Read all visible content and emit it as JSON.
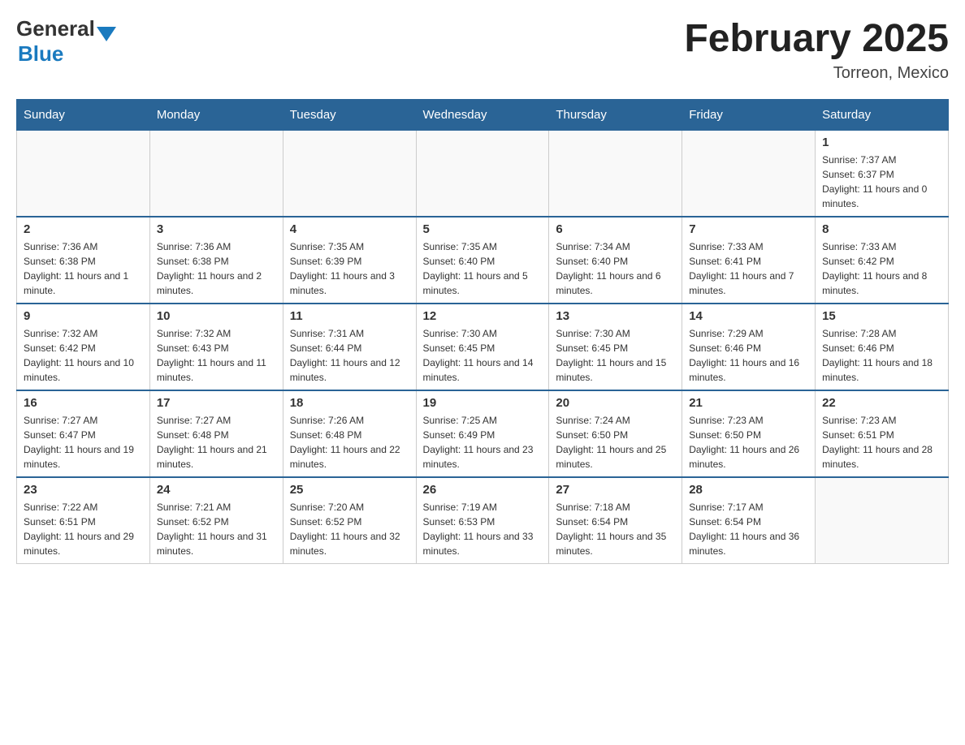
{
  "header": {
    "logo_general": "General",
    "logo_blue": "Blue",
    "title": "February 2025",
    "subtitle": "Torreon, Mexico"
  },
  "days_of_week": [
    "Sunday",
    "Monday",
    "Tuesday",
    "Wednesday",
    "Thursday",
    "Friday",
    "Saturday"
  ],
  "weeks": [
    [
      {
        "day": "",
        "info": ""
      },
      {
        "day": "",
        "info": ""
      },
      {
        "day": "",
        "info": ""
      },
      {
        "day": "",
        "info": ""
      },
      {
        "day": "",
        "info": ""
      },
      {
        "day": "",
        "info": ""
      },
      {
        "day": "1",
        "info": "Sunrise: 7:37 AM\nSunset: 6:37 PM\nDaylight: 11 hours and 0 minutes."
      }
    ],
    [
      {
        "day": "2",
        "info": "Sunrise: 7:36 AM\nSunset: 6:38 PM\nDaylight: 11 hours and 1 minute."
      },
      {
        "day": "3",
        "info": "Sunrise: 7:36 AM\nSunset: 6:38 PM\nDaylight: 11 hours and 2 minutes."
      },
      {
        "day": "4",
        "info": "Sunrise: 7:35 AM\nSunset: 6:39 PM\nDaylight: 11 hours and 3 minutes."
      },
      {
        "day": "5",
        "info": "Sunrise: 7:35 AM\nSunset: 6:40 PM\nDaylight: 11 hours and 5 minutes."
      },
      {
        "day": "6",
        "info": "Sunrise: 7:34 AM\nSunset: 6:40 PM\nDaylight: 11 hours and 6 minutes."
      },
      {
        "day": "7",
        "info": "Sunrise: 7:33 AM\nSunset: 6:41 PM\nDaylight: 11 hours and 7 minutes."
      },
      {
        "day": "8",
        "info": "Sunrise: 7:33 AM\nSunset: 6:42 PM\nDaylight: 11 hours and 8 minutes."
      }
    ],
    [
      {
        "day": "9",
        "info": "Sunrise: 7:32 AM\nSunset: 6:42 PM\nDaylight: 11 hours and 10 minutes."
      },
      {
        "day": "10",
        "info": "Sunrise: 7:32 AM\nSunset: 6:43 PM\nDaylight: 11 hours and 11 minutes."
      },
      {
        "day": "11",
        "info": "Sunrise: 7:31 AM\nSunset: 6:44 PM\nDaylight: 11 hours and 12 minutes."
      },
      {
        "day": "12",
        "info": "Sunrise: 7:30 AM\nSunset: 6:45 PM\nDaylight: 11 hours and 14 minutes."
      },
      {
        "day": "13",
        "info": "Sunrise: 7:30 AM\nSunset: 6:45 PM\nDaylight: 11 hours and 15 minutes."
      },
      {
        "day": "14",
        "info": "Sunrise: 7:29 AM\nSunset: 6:46 PM\nDaylight: 11 hours and 16 minutes."
      },
      {
        "day": "15",
        "info": "Sunrise: 7:28 AM\nSunset: 6:46 PM\nDaylight: 11 hours and 18 minutes."
      }
    ],
    [
      {
        "day": "16",
        "info": "Sunrise: 7:27 AM\nSunset: 6:47 PM\nDaylight: 11 hours and 19 minutes."
      },
      {
        "day": "17",
        "info": "Sunrise: 7:27 AM\nSunset: 6:48 PM\nDaylight: 11 hours and 21 minutes."
      },
      {
        "day": "18",
        "info": "Sunrise: 7:26 AM\nSunset: 6:48 PM\nDaylight: 11 hours and 22 minutes."
      },
      {
        "day": "19",
        "info": "Sunrise: 7:25 AM\nSunset: 6:49 PM\nDaylight: 11 hours and 23 minutes."
      },
      {
        "day": "20",
        "info": "Sunrise: 7:24 AM\nSunset: 6:50 PM\nDaylight: 11 hours and 25 minutes."
      },
      {
        "day": "21",
        "info": "Sunrise: 7:23 AM\nSunset: 6:50 PM\nDaylight: 11 hours and 26 minutes."
      },
      {
        "day": "22",
        "info": "Sunrise: 7:23 AM\nSunset: 6:51 PM\nDaylight: 11 hours and 28 minutes."
      }
    ],
    [
      {
        "day": "23",
        "info": "Sunrise: 7:22 AM\nSunset: 6:51 PM\nDaylight: 11 hours and 29 minutes."
      },
      {
        "day": "24",
        "info": "Sunrise: 7:21 AM\nSunset: 6:52 PM\nDaylight: 11 hours and 31 minutes."
      },
      {
        "day": "25",
        "info": "Sunrise: 7:20 AM\nSunset: 6:52 PM\nDaylight: 11 hours and 32 minutes."
      },
      {
        "day": "26",
        "info": "Sunrise: 7:19 AM\nSunset: 6:53 PM\nDaylight: 11 hours and 33 minutes."
      },
      {
        "day": "27",
        "info": "Sunrise: 7:18 AM\nSunset: 6:54 PM\nDaylight: 11 hours and 35 minutes."
      },
      {
        "day": "28",
        "info": "Sunrise: 7:17 AM\nSunset: 6:54 PM\nDaylight: 11 hours and 36 minutes."
      },
      {
        "day": "",
        "info": ""
      }
    ]
  ]
}
